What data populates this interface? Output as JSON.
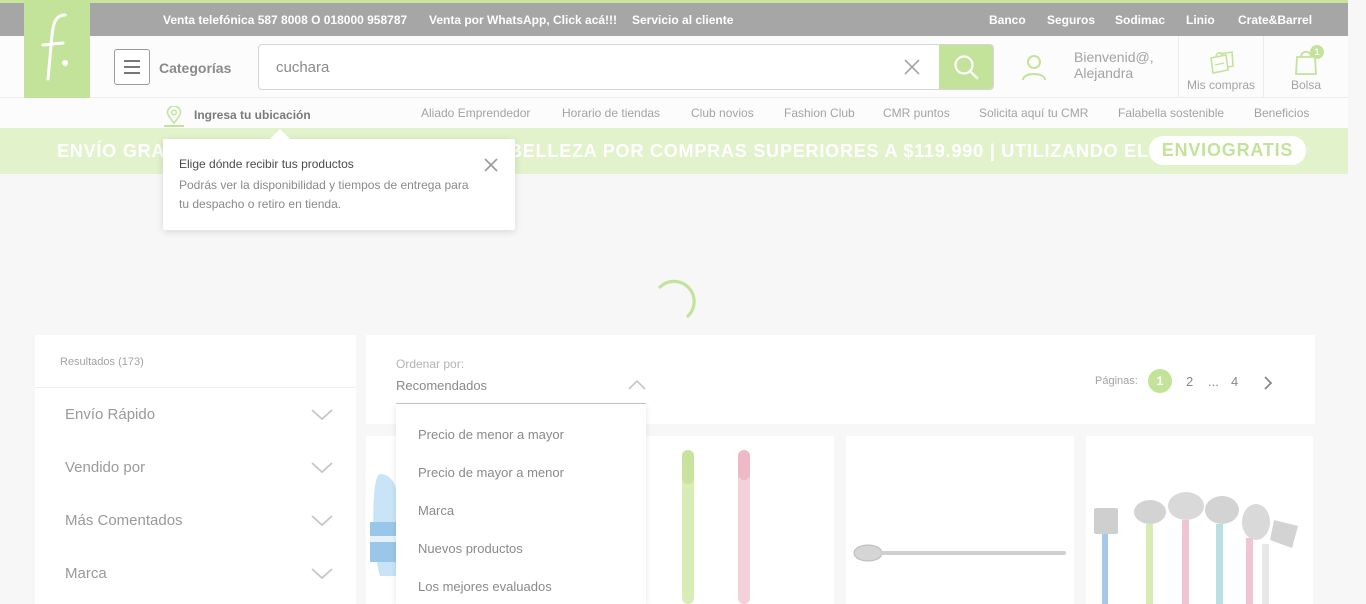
{
  "topbar": {
    "links_left": [
      "Venta telefónica 587 8008 O 018000 958787",
      "Venta por WhatsApp, Click acá!!!",
      "Servicio al cliente"
    ],
    "links_right": [
      "Banco",
      "Seguros",
      "Sodimac",
      "Linio",
      "Crate&Barrel"
    ]
  },
  "header": {
    "categories_label": "Categorías",
    "search_value": "cuchara",
    "greeting_line1": "Bienvenid@,",
    "greeting_line2": "Alejandra",
    "purchases_label": "Mis compras",
    "bag_label": "Bolsa",
    "bag_count": "1"
  },
  "subnav": {
    "location_label": "Ingresa tu ubicación",
    "links": [
      "Aliado Emprendedor",
      "Horario de tiendas",
      "Club novios",
      "Fashion Club",
      "CMR puntos",
      "Solicita aquí tu CMR",
      "Falabella sostenible",
      "Beneficios"
    ]
  },
  "promo": {
    "text_left": "ENVÍO GRA",
    "text_right": "BELLEZA POR COMPRAS SUPERIORES A $119.990 | UTILIZANDO EL CUPÓN",
    "coupon": "ENVIOGRATIS"
  },
  "location_popover": {
    "title": "Elige dónde recibir tus productos",
    "body": "Podrás ver la disponibilidad y tiempos de entrega para tu despacho o retiro en tienda."
  },
  "filters": {
    "results": "Resultados (173)",
    "items": [
      "Envío Rápido",
      "Vendido por",
      "Más Comentados",
      "Marca"
    ]
  },
  "sort": {
    "label": "Ordenar por:",
    "value": "Recomendados",
    "options": [
      "Precio de menor a mayor",
      "Precio de mayor a menor",
      "Marca",
      "Nuevos productos",
      "Los mejores evaluados"
    ]
  },
  "pagination": {
    "label": "Páginas:",
    "current": "1",
    "items": [
      "2",
      "...",
      "4"
    ]
  },
  "colors": {
    "accent": "#c3e39a",
    "topbar": "#a6a6a6",
    "promo": "#e2f2cb"
  }
}
